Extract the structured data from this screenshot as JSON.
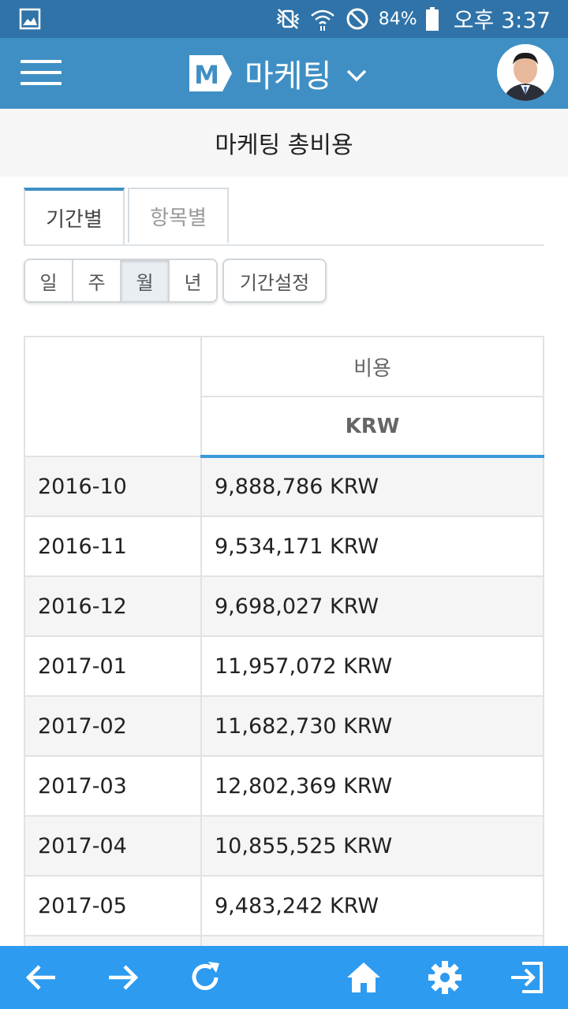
{
  "status_bar": {
    "battery": "84%",
    "time": "오후 3:37"
  },
  "app_bar": {
    "title": "마케팅",
    "logo_letter": "M"
  },
  "page": {
    "title": "마케팅 총비용"
  },
  "tabs": [
    {
      "label": "기간별",
      "active": true
    },
    {
      "label": "항목별",
      "active": false
    }
  ],
  "period_buttons": [
    {
      "label": "일"
    },
    {
      "label": "주"
    },
    {
      "label": "월",
      "selected": true
    },
    {
      "label": "년"
    }
  ],
  "range_button": "기간설정",
  "table": {
    "header_cost": "비용",
    "header_unit": "KRW",
    "rows": [
      {
        "period": "2016-10",
        "value": "9,888,786 KRW"
      },
      {
        "period": "2016-11",
        "value": "9,534,171 KRW"
      },
      {
        "period": "2016-12",
        "value": "9,698,027 KRW"
      },
      {
        "period": "2017-01",
        "value": "11,957,072 KRW"
      },
      {
        "period": "2017-02",
        "value": "11,682,730 KRW"
      },
      {
        "period": "2017-03",
        "value": "12,802,369 KRW"
      },
      {
        "period": "2017-04",
        "value": "10,855,525 KRW"
      },
      {
        "period": "2017-05",
        "value": "9,483,242 KRW"
      }
    ]
  },
  "colors": {
    "status_bar": "#2f73a8",
    "app_bar": "#3f8fc4",
    "bottom_nav": "#2d9bf0",
    "accent": "#3a9ad9"
  },
  "icons": {
    "bottom_nav": [
      "back-arrow-icon",
      "forward-arrow-icon",
      "refresh-icon",
      "home-icon",
      "gear-icon",
      "logout-icon"
    ]
  }
}
